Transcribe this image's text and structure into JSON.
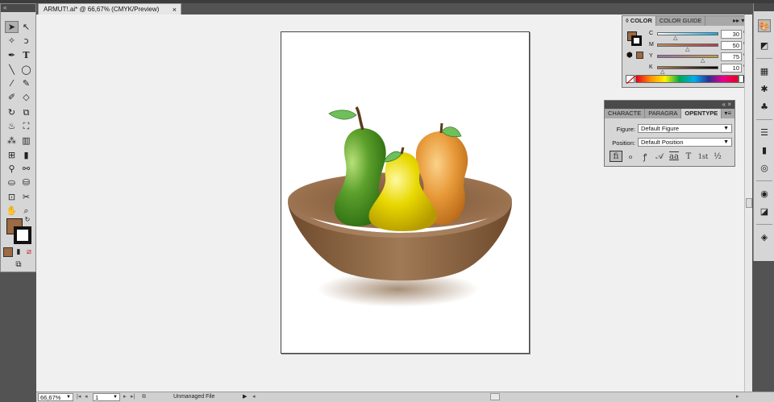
{
  "document": {
    "tab_title": "ARMUT!.ai* @ 66,67% (CMYK/Preview)",
    "close_glyph": "×"
  },
  "toolbox": {
    "collapse_glyph": "«",
    "tools": [
      "selection",
      "direct-selection",
      "magic-wand",
      "lasso",
      "pen",
      "type",
      "line",
      "ellipse",
      "paintbrush",
      "pencil",
      "blob-brush",
      "eraser",
      "rotate",
      "scale",
      "warp",
      "free-transform",
      "symbol-sprayer",
      "graph",
      "mesh",
      "gradient",
      "eyedropper",
      "blend",
      "live-paint",
      "live-paint-selection",
      "artboard",
      "slice",
      "hand",
      "zoom"
    ],
    "fill_color": "#9c6a43"
  },
  "color_panel": {
    "tab_color": "COLOR",
    "tab_guide": "COLOR GUIDE",
    "menu_glyph": "▸▸ ▾≡",
    "channels": [
      {
        "label": "C",
        "value": "30",
        "unit": "%"
      },
      {
        "label": "M",
        "value": "50",
        "unit": "%"
      },
      {
        "label": "Y",
        "value": "75",
        "unit": "%"
      },
      {
        "label": "K",
        "value": "10",
        "unit": "%"
      }
    ]
  },
  "opentype_panel": {
    "tabs": [
      "CHARACTE",
      "PARAGRA",
      "OPENTYPE"
    ],
    "active_tab": "OPENTYPE",
    "topgrip": "« ×",
    "menu_glyph": "▾≡",
    "figure_label": "Figure:",
    "figure_value": "Default Figure",
    "position_label": "Position:",
    "position_value": "Default Position",
    "glyph_buttons": [
      "fi",
      "ℴ",
      "ꝭ",
      "𝒜",
      "aa",
      "T",
      "1st",
      "½"
    ]
  },
  "status": {
    "zoom": "66,67%",
    "artboard_num": "1",
    "file_status": "Unmanaged File"
  },
  "artwork": {
    "bowl_color": "#8a6140",
    "pear_green": "#5ca02c",
    "pear_yellow": "#e8d800",
    "pear_orange": "#e89a3a",
    "leaf_color": "#6fbf5a"
  }
}
